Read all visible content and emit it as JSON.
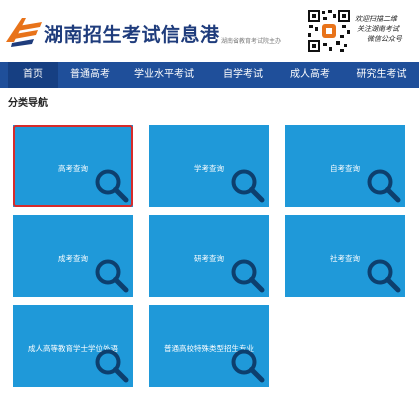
{
  "header": {
    "title": "湖南招生考试信息港",
    "subtitle": "湖南省教育考试院主办",
    "qr_text": [
      "欢迎扫描二维",
      "关注湖南考试",
      "微信公众号"
    ],
    "brand_color": "#1f3c7c"
  },
  "nav": {
    "items": [
      {
        "label": "首页",
        "active": true
      },
      {
        "label": "普通高考"
      },
      {
        "label": "学业水平考试"
      },
      {
        "label": "自学考试"
      },
      {
        "label": "成人高考"
      },
      {
        "label": "研究生考试"
      }
    ],
    "color": "#1f4f9a"
  },
  "section": {
    "title": "分类导航"
  },
  "tiles": [
    {
      "label": "高考查询",
      "selected": true
    },
    {
      "label": "学考查询"
    },
    {
      "label": "自考查询"
    },
    {
      "label": "成考查询"
    },
    {
      "label": "研考查询"
    },
    {
      "label": "社考查询"
    },
    {
      "label": "成人高等教育学士学位外语"
    },
    {
      "label": "普通高校特殊类型招生专业"
    }
  ],
  "colors": {
    "tile": "#1f99d9",
    "selected_border": "#d62b2b"
  }
}
